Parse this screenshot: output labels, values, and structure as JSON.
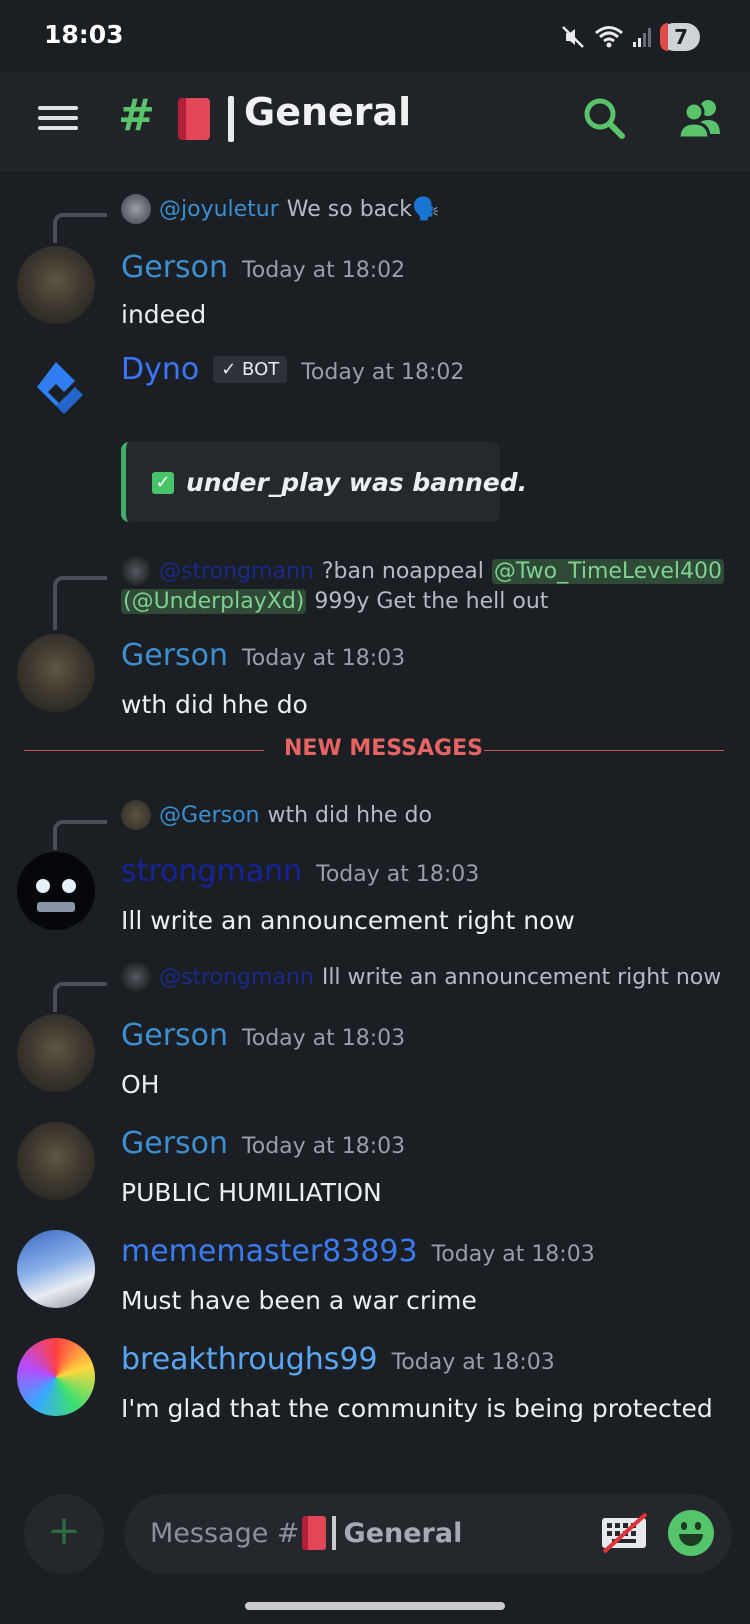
{
  "status_bar": {
    "time": "18:03",
    "battery_level": "7"
  },
  "header": {
    "hash": "#",
    "channel_name": "General"
  },
  "messages": {
    "m1": {
      "reply_author": "@joyuletur",
      "reply_text": "We so back🗣️",
      "author": "Gerson",
      "time": "Today at 18:02",
      "body": "indeed"
    },
    "m2": {
      "author": "Dyno",
      "bot_tag": "✓ BOT",
      "time": "Today at 18:02",
      "embed_text": "under_play was banned."
    },
    "m3": {
      "reply_author": "@strongmann",
      "reply_text": "?ban noappeal",
      "reply_mention1": "@Two_TimeLevel400",
      "reply_mention2": "(@UnderplayXd)",
      "reply_text2": "999y Get the hell out",
      "author": "Gerson",
      "time": "Today at 18:03",
      "body": "wth did hhe do"
    },
    "new_messages_label": "NEW MESSAGES",
    "m4": {
      "reply_author": "@Gerson",
      "reply_text": "wth did hhe do",
      "author": "strongmann",
      "time": "Today at 18:03",
      "body": "Ill write an announcement right now"
    },
    "m5": {
      "reply_author": "@strongmann",
      "reply_text": "Ill write an announcement right now",
      "author": "Gerson",
      "time": "Today at 18:03",
      "body": "OH"
    },
    "m6": {
      "author": "Gerson",
      "time": "Today at 18:03",
      "body": "PUBLIC HUMILIATION"
    },
    "m7": {
      "author": "mememaster83893",
      "time": "Today at 18:03",
      "body": "Must have been a war crime"
    },
    "m8": {
      "author": "breakthroughs99",
      "time": "Today at 18:03",
      "body": "I'm glad that the community is being protected"
    }
  },
  "composer": {
    "plus": "+",
    "placeholder_prefix": "Message #",
    "placeholder_channel": "General"
  },
  "icons": {
    "menu": "hamburger-icon",
    "search": "search-icon",
    "members": "members-icon",
    "keyboard": "keyboard-off-icon",
    "emoji": "emoji-icon",
    "check": "checkbox-icon"
  },
  "colors": {
    "accent_green": "#59c26a",
    "background": "#1b1e22",
    "new_messages": "#e76464"
  }
}
